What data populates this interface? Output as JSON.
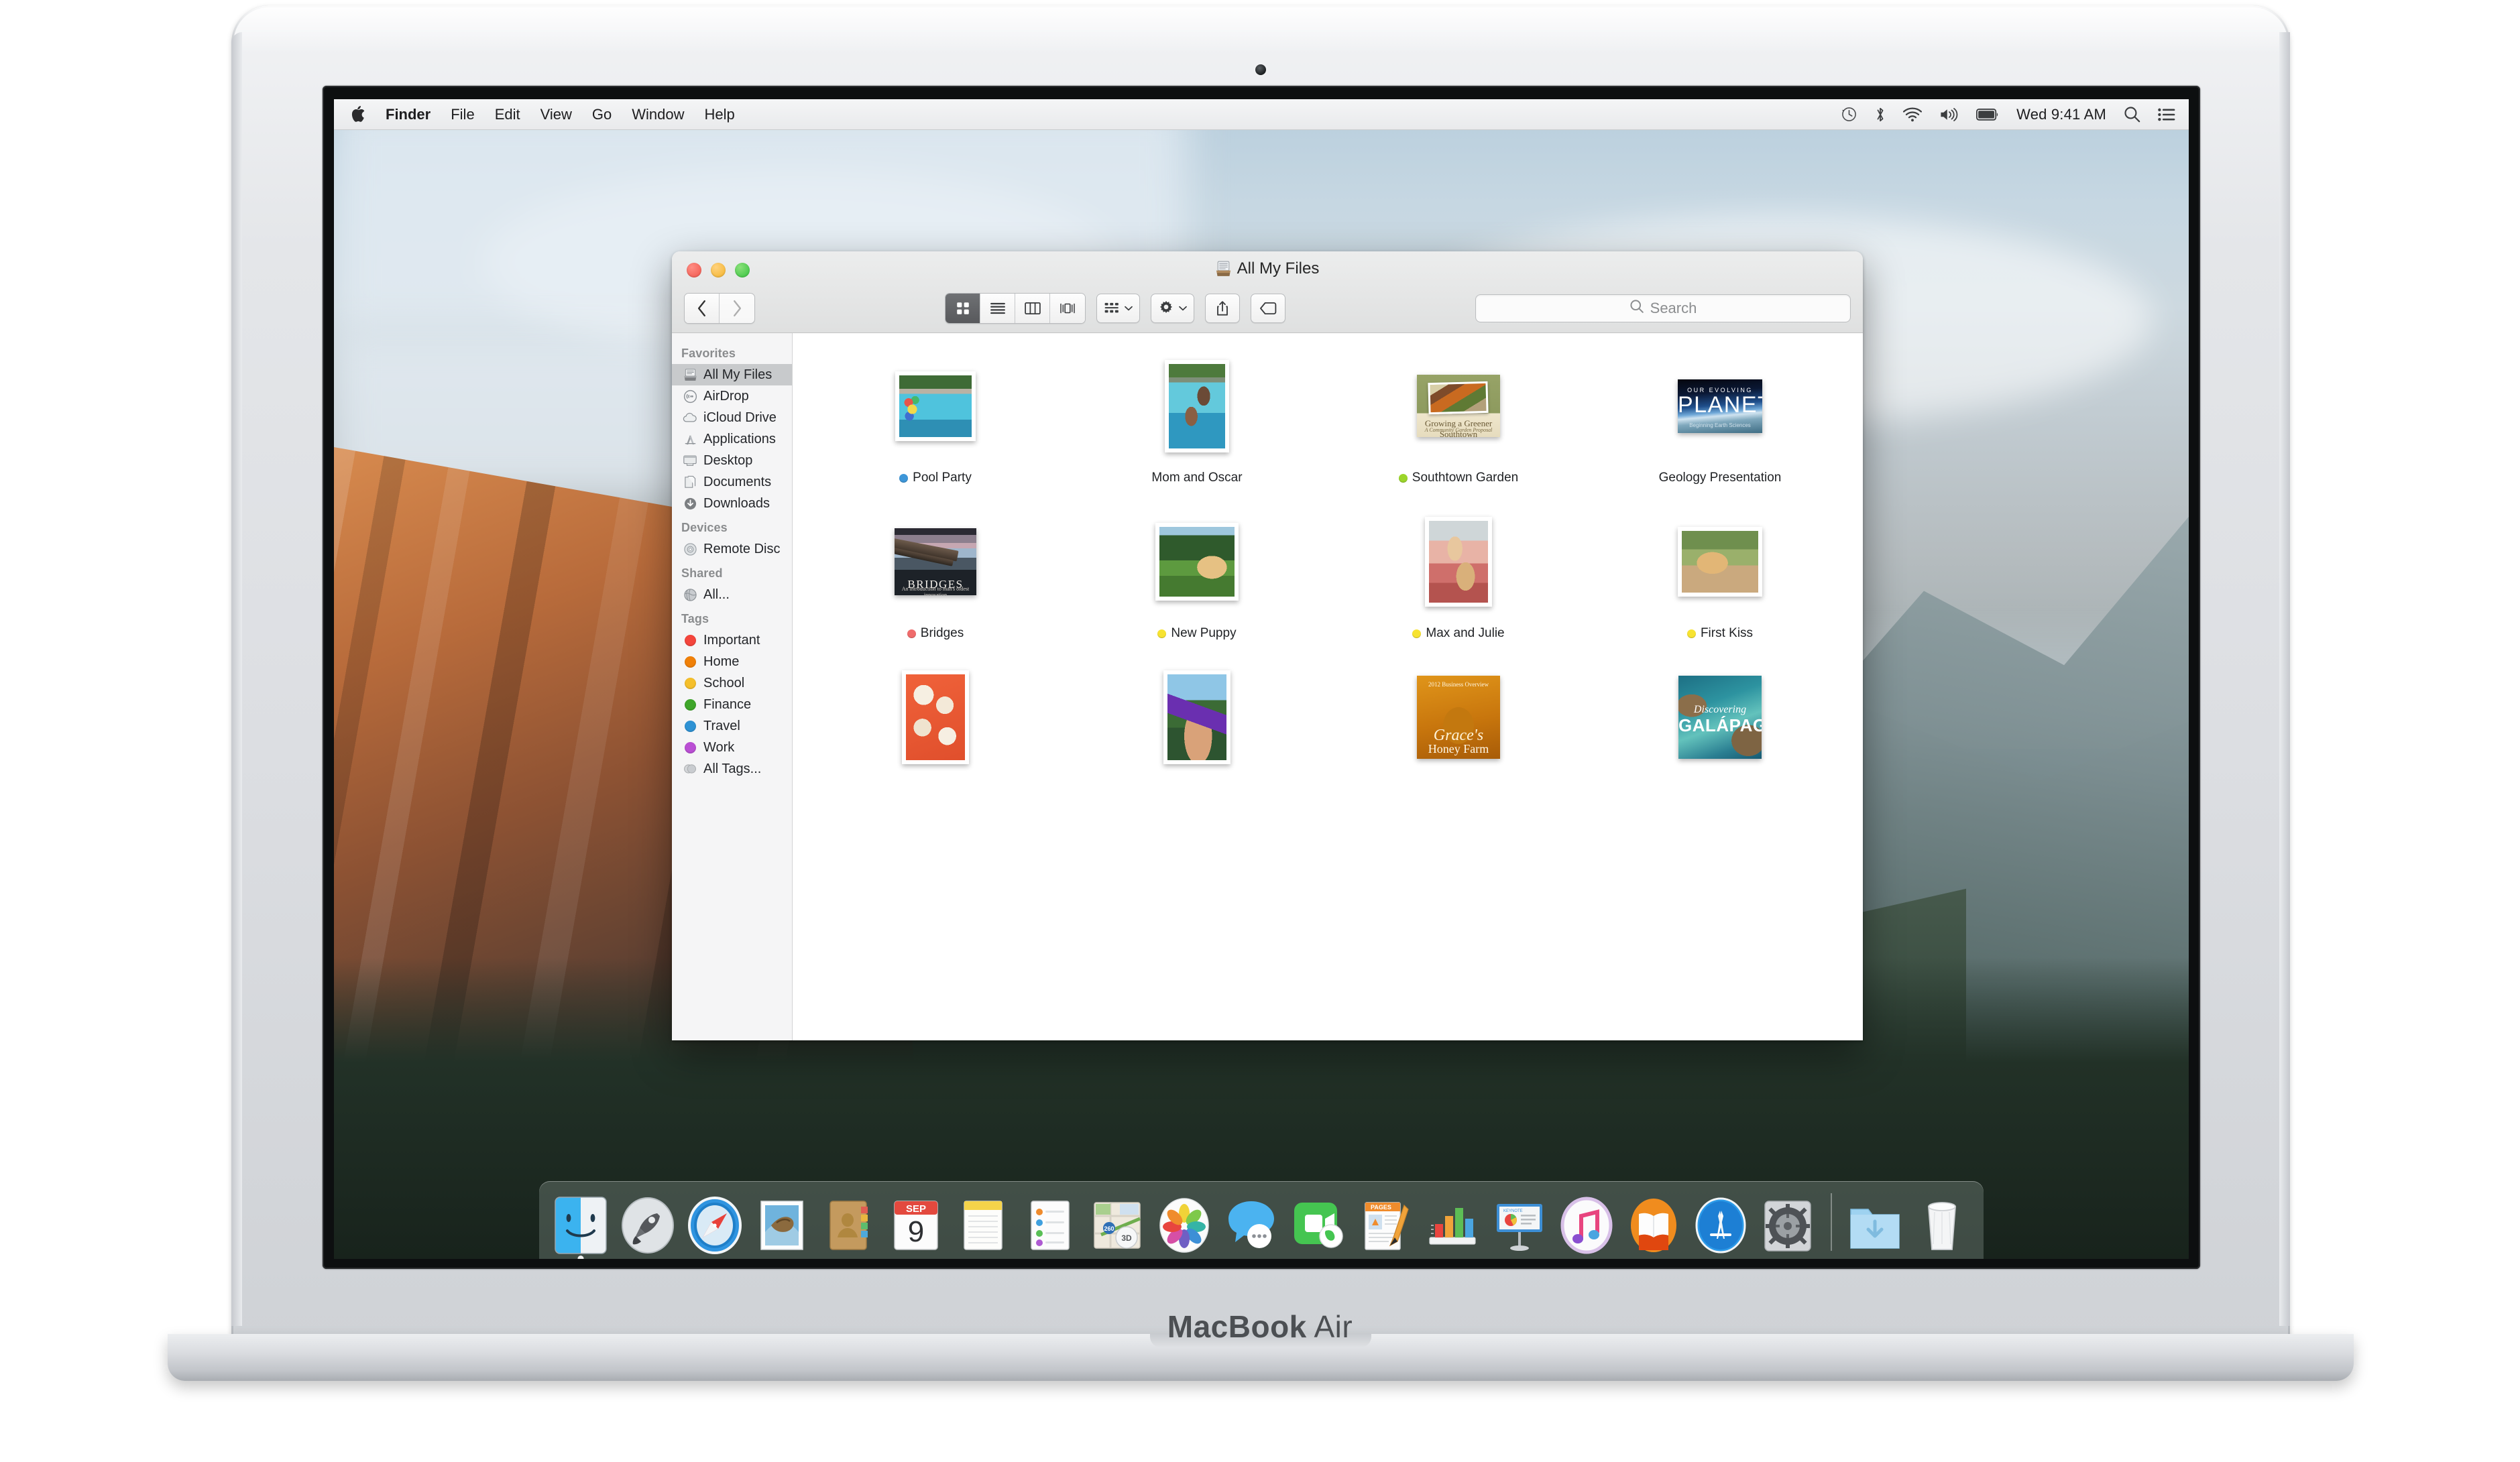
{
  "device": {
    "brand_bold": "MacBook",
    "brand_light": " Air"
  },
  "menubar": {
    "apple_icon": "apple-logo",
    "items": [
      {
        "label": "Finder",
        "bold": true
      },
      {
        "label": "File",
        "bold": false
      },
      {
        "label": "Edit",
        "bold": false
      },
      {
        "label": "View",
        "bold": false
      },
      {
        "label": "Go",
        "bold": false
      },
      {
        "label": "Window",
        "bold": false
      },
      {
        "label": "Help",
        "bold": false
      }
    ],
    "status_icons": [
      "time-machine-icon",
      "bluetooth-icon",
      "wifi-icon",
      "volume-icon",
      "battery-icon"
    ],
    "clock": "Wed 9:41 AM",
    "spotlight_icon": "search-icon",
    "notification_center_icon": "notification-center-icon"
  },
  "finder": {
    "title": "All My Files",
    "title_icon": "all-my-files-icon",
    "nav": {
      "back_label": "‹",
      "forward_label": "›"
    },
    "view_buttons": [
      {
        "name": "icon-view",
        "selected": true
      },
      {
        "name": "list-view",
        "selected": false
      },
      {
        "name": "column-view",
        "selected": false
      },
      {
        "name": "cover-flow-view",
        "selected": false
      }
    ],
    "arrange_button": "arrange-by-button",
    "action_button": "action-gear-button",
    "share_button": "share-button",
    "tags_button": "tags-button",
    "search": {
      "placeholder": "Search",
      "value": "",
      "icon": "search-icon"
    },
    "sidebar": [
      {
        "header": "Favorites",
        "items": [
          {
            "label": "All My Files",
            "icon": "all-my-files-icon",
            "selected": true
          },
          {
            "label": "AirDrop",
            "icon": "airdrop-icon",
            "selected": false
          },
          {
            "label": "iCloud Drive",
            "icon": "icloud-icon",
            "selected": false
          },
          {
            "label": "Applications",
            "icon": "applications-icon",
            "selected": false
          },
          {
            "label": "Desktop",
            "icon": "desktop-icon",
            "selected": false
          },
          {
            "label": "Documents",
            "icon": "documents-icon",
            "selected": false
          },
          {
            "label": "Downloads",
            "icon": "downloads-icon",
            "selected": false
          }
        ]
      },
      {
        "header": "Devices",
        "items": [
          {
            "label": "Remote Disc",
            "icon": "remote-disc-icon",
            "selected": false
          }
        ]
      },
      {
        "header": "Shared",
        "items": [
          {
            "label": "All...",
            "icon": "shared-all-icon",
            "selected": false
          }
        ]
      },
      {
        "header": "Tags",
        "items": [
          {
            "label": "Important",
            "icon": "tag-dot",
            "color": "#f4453c",
            "selected": false
          },
          {
            "label": "Home",
            "icon": "tag-dot",
            "color": "#f08008",
            "selected": false
          },
          {
            "label": "School",
            "icon": "tag-dot",
            "color": "#f5bf2b",
            "selected": false
          },
          {
            "label": "Finance",
            "icon": "tag-dot",
            "color": "#3fa62a",
            "selected": false
          },
          {
            "label": "Travel",
            "icon": "tag-dot",
            "color": "#2e92d4",
            "selected": false
          },
          {
            "label": "Work",
            "icon": "tag-dot",
            "color": "#ba4fd4",
            "selected": false
          },
          {
            "label": "All Tags...",
            "icon": "all-tags-icon",
            "color": "#c8cacc",
            "selected": false
          }
        ]
      }
    ],
    "files": [
      {
        "label": "Pool Party",
        "tag_color": "#3d96d8",
        "kind": "photo",
        "orientation": "landscape",
        "art": "img-pool"
      },
      {
        "label": "Mom and Oscar",
        "tag_color": null,
        "kind": "photo",
        "orientation": "portrait",
        "art": "img-mom"
      },
      {
        "label": "Southtown Garden",
        "tag_color": "#9bd52a",
        "kind": "document",
        "orientation": "landscape",
        "art": "img-garden",
        "doc_title": "Growing a Greener Southtown",
        "doc_subtitle": "A Community Garden Proposal"
      },
      {
        "label": "Geology Presentation",
        "tag_color": null,
        "kind": "document",
        "orientation": "landscape",
        "art": "img-planet",
        "doc_kicker": "OUR EVOLVING",
        "doc_title": "PLANET",
        "doc_subtitle": "Beginning Earth Sciences"
      },
      {
        "label": "Bridges",
        "tag_color": "#ef6b6b",
        "kind": "document",
        "orientation": "landscape",
        "art": "img-bridges",
        "doc_title": "BRIDGES",
        "doc_subtitle": "An introduction to man's oldest innovation"
      },
      {
        "label": "New Puppy",
        "tag_color": "#f7e331",
        "kind": "photo",
        "orientation": "square",
        "art": "img-puppy"
      },
      {
        "label": "Max and Julie",
        "tag_color": "#f7e331",
        "kind": "photo",
        "orientation": "portrait",
        "art": "img-maxjulie"
      },
      {
        "label": "First Kiss",
        "tag_color": "#f7e331",
        "kind": "photo",
        "orientation": "landscape",
        "art": "img-firstkiss"
      },
      {
        "label": "",
        "tag_color": null,
        "kind": "photo",
        "orientation": "portrait",
        "art": "img-cupcakes"
      },
      {
        "label": "",
        "tag_color": null,
        "kind": "photo",
        "orientation": "portrait",
        "art": "img-partyhat"
      },
      {
        "label": "",
        "tag_color": null,
        "kind": "document",
        "orientation": "square",
        "art": "img-honey",
        "doc_kicker": "2012 Business Overview",
        "doc_title": "Grace's",
        "doc_subtitle": "Honey Farm"
      },
      {
        "label": "",
        "tag_color": null,
        "kind": "document",
        "orientation": "square",
        "art": "img-galapagos",
        "doc_title": "Discovering",
        "doc_subtitle": "GALÁPAGOS"
      }
    ]
  },
  "dock": {
    "items": [
      {
        "name": "finder-icon",
        "label": "Finder",
        "running": true
      },
      {
        "name": "launchpad-icon",
        "label": "Launchpad",
        "running": false
      },
      {
        "name": "safari-icon",
        "label": "Safari",
        "running": false
      },
      {
        "name": "mail-icon",
        "label": "Mail",
        "running": false
      },
      {
        "name": "contacts-icon",
        "label": "Contacts",
        "running": false
      },
      {
        "name": "calendar-icon",
        "label": "Calendar",
        "running": false,
        "month": "SEP",
        "day": "9"
      },
      {
        "name": "notes-icon",
        "label": "Notes",
        "running": false
      },
      {
        "name": "reminders-icon",
        "label": "Reminders",
        "running": false
      },
      {
        "name": "maps-icon",
        "label": "Maps",
        "running": false
      },
      {
        "name": "photos-icon",
        "label": "Photos",
        "running": false
      },
      {
        "name": "messages-icon",
        "label": "Messages",
        "running": false
      },
      {
        "name": "facetime-icon",
        "label": "FaceTime",
        "running": false
      },
      {
        "name": "pages-icon",
        "label": "Pages",
        "running": false
      },
      {
        "name": "numbers-icon",
        "label": "Numbers",
        "running": false
      },
      {
        "name": "keynote-icon",
        "label": "Keynote",
        "running": false
      },
      {
        "name": "itunes-icon",
        "label": "iTunes",
        "running": false
      },
      {
        "name": "ibooks-icon",
        "label": "iBooks",
        "running": false
      },
      {
        "name": "app-store-icon",
        "label": "App Store",
        "running": false
      },
      {
        "name": "system-preferences-icon",
        "label": "System Preferences",
        "running": false
      }
    ],
    "right_items": [
      {
        "name": "downloads-folder-icon",
        "label": "Downloads"
      },
      {
        "name": "trash-icon",
        "label": "Trash"
      }
    ]
  }
}
